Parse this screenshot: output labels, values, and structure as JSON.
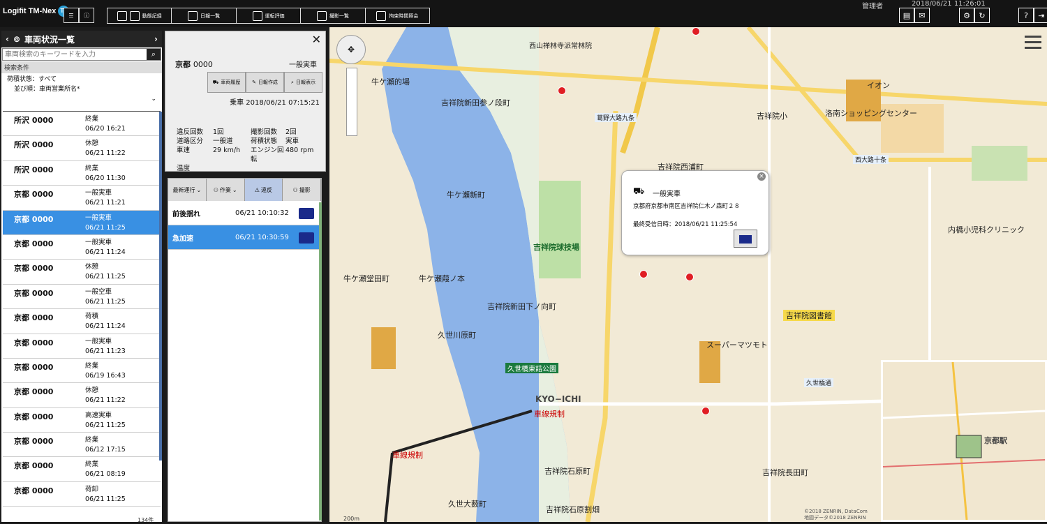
{
  "header": {
    "logo": "Logifit TM-Nex",
    "logo_badge": "TP",
    "user": "管理者",
    "datetime": "2018/06/21 11:26:01",
    "nav": [
      {
        "label": "動態記録"
      },
      {
        "label": "日報一覧"
      },
      {
        "label": "運転評価"
      },
      {
        "label": "撮影一覧"
      },
      {
        "label": "拘束時間照会"
      }
    ]
  },
  "sidebar": {
    "title": "車両状況一覧",
    "search_placeholder": "車両検索のキーワードを入力",
    "cond_title": "検索条件",
    "cond1": "荷積状態：すべて",
    "cond2": "並び順：車両営業所名*",
    "count": "134件",
    "vehicles": [
      {
        "name": "所沢 0000",
        "status": "終業",
        "time": "06/20 16:21"
      },
      {
        "name": "所沢 0000",
        "status": "休憩",
        "time": "06/21 11:22"
      },
      {
        "name": "所沢 0000",
        "status": "終業",
        "time": "06/20 11:30"
      },
      {
        "name": "京都 0000",
        "status": "一般実車",
        "time": "06/21 11:21"
      },
      {
        "name": "京都 0000",
        "status": "一般実車",
        "time": "06/21 11:25"
      },
      {
        "name": "京都 0000",
        "status": "一般実車",
        "time": "06/21 11:24"
      },
      {
        "name": "京都 0000",
        "status": "休憩",
        "time": "06/21 11:25"
      },
      {
        "name": "京都 0000",
        "status": "一般空車",
        "time": "06/21 11:25"
      },
      {
        "name": "京都 0000",
        "status": "荷積",
        "time": "06/21 11:24"
      },
      {
        "name": "京都 0000",
        "status": "一般実車",
        "time": "06/21 11:23"
      },
      {
        "name": "京都 0000",
        "status": "終業",
        "time": "06/19 16:43"
      },
      {
        "name": "京都 0000",
        "status": "休憩",
        "time": "06/21 11:22"
      },
      {
        "name": "京都 0000",
        "status": "高速実車",
        "time": "06/21 11:25"
      },
      {
        "name": "京都 0000",
        "status": "終業",
        "time": "06/12 17:15"
      },
      {
        "name": "京都 0000",
        "status": "終業",
        "time": "06/21 08:19"
      },
      {
        "name": "京都 0000",
        "status": "荷卸",
        "time": "06/21 11:25"
      }
    ]
  },
  "detail": {
    "plate_area": "京都",
    "plate_no": "0000",
    "state": "一般実車",
    "btn1": "車両履歴",
    "btn2": "日報作成",
    "btn3": "日報表示",
    "board_time": "乗車 2018/06/21 07:15:21",
    "stats": [
      "違反回数",
      "1回",
      "撮影回数",
      "2回",
      "道路区分",
      "一般道",
      "荷積状態",
      "実車",
      "車速",
      "29 km/h",
      "エンジン回転",
      "480 rpm",
      "温度",
      "",
      "",
      ""
    ]
  },
  "events": {
    "tabs": [
      "最新運行",
      "作業",
      "違反",
      "撮影"
    ],
    "rows": [
      {
        "type": "前後揺れ",
        "time": "06/21 10:10:32"
      },
      {
        "type": "急加速",
        "time": "06/21 10:30:59"
      }
    ]
  },
  "popup": {
    "title": "一般実車",
    "address": "京都府京都市南区吉祥院仁木ノ森町２８",
    "received": "最終受信日時：2018/06/21 11:25:54"
  },
  "map": {
    "labels": [
      "牛ケ瀬的場",
      "吉祥院新田参ノ段町",
      "牛ケ瀬新町",
      "牛ケ瀬堂田町",
      "牛ケ瀬葭ノ本",
      "吉祥院球技場",
      "吉祥院新田下ノ向町",
      "久世川原町",
      "吉祥院西浦町",
      "吉祥院図書館",
      "スーパーマツモト",
      "吉祥院石原町",
      "吉祥院長田町",
      "久世大薮町",
      "吉祥院石原割畑",
      "久世橋東詰公園",
      "西大路十条",
      "洛南ショッピングセンター",
      "イオン",
      "西山禅林寺派常林院",
      "吉祥院小",
      "内橋小児科クリニック",
      "KYO−ICHI",
      "久世橋通",
      "京都駅",
      "葛野大路九条",
      "車線規制"
    ],
    "scale": "200m",
    "copyright1": "©2018 ZENRIN, DataCom",
    "copyright2": "地図データ©2018 ZENRIN"
  }
}
